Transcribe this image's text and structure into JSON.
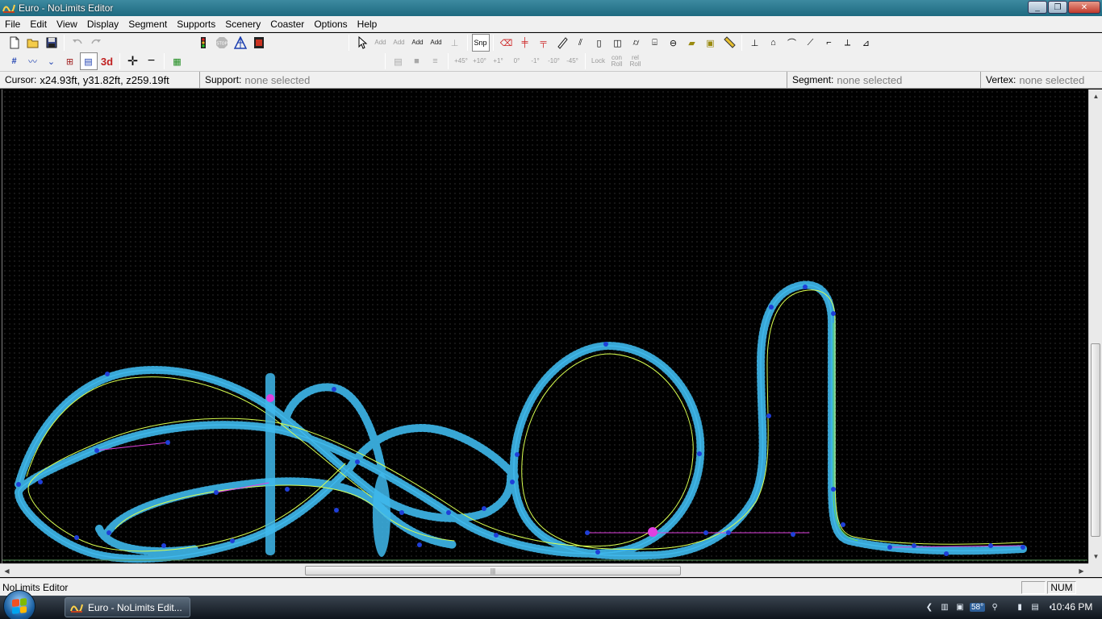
{
  "window": {
    "title": "Euro - NoLimits Editor",
    "buttons": {
      "minimize": "_",
      "restore": "❐",
      "close": "✕"
    }
  },
  "menu": [
    "File",
    "Edit",
    "View",
    "Display",
    "Segment",
    "Supports",
    "Scenery",
    "Coaster",
    "Options",
    "Help"
  ],
  "toolbar2_text_buttons": {
    "snap": "Snp",
    "add1": "Add",
    "add2": "Add",
    "add3": "Add",
    "add4": "Add",
    "deg_p45": "+45°",
    "deg_p10": "+10°",
    "deg_p1": "+1°",
    "deg_0": "0°",
    "deg_m1": "-1°",
    "deg_m10": "-10°",
    "deg_m45": "-45°",
    "lock": "Lock",
    "con_roll": "con Roll",
    "rel_roll": "rel Roll",
    "view_3d": "3d"
  },
  "infobar": {
    "cursor_label": "Cursor:",
    "cursor_value": "x24.93ft, y31.82ft, z259.19ft",
    "support_label": "Support:",
    "support_value": "none selected",
    "segment_label": "Segment:",
    "segment_value": "none selected",
    "vertex_label": "Vertex:",
    "vertex_value": "none selected"
  },
  "statusbar": {
    "text": "NoLimits Editor",
    "num": "NUM"
  },
  "taskbar": {
    "task_label": "Euro - NoLimits Edit...",
    "temperature": "58°",
    "clock": "10:46 PM"
  },
  "colors": {
    "track_rails": "#3fb8ec",
    "spline": "#d8ff50",
    "vertex": "#1f3fd8",
    "link": "#e040e0",
    "grid_dot": "#5a5a5a"
  },
  "icons": [
    "new-file-icon",
    "open-folder-icon",
    "save-icon",
    "undo-icon",
    "redo-icon",
    "traffic-light-icon",
    "stop-icon",
    "triangle-grid-icon",
    "film-icon",
    "pointer-icon",
    "ruler-icon",
    "pencil-icon"
  ]
}
